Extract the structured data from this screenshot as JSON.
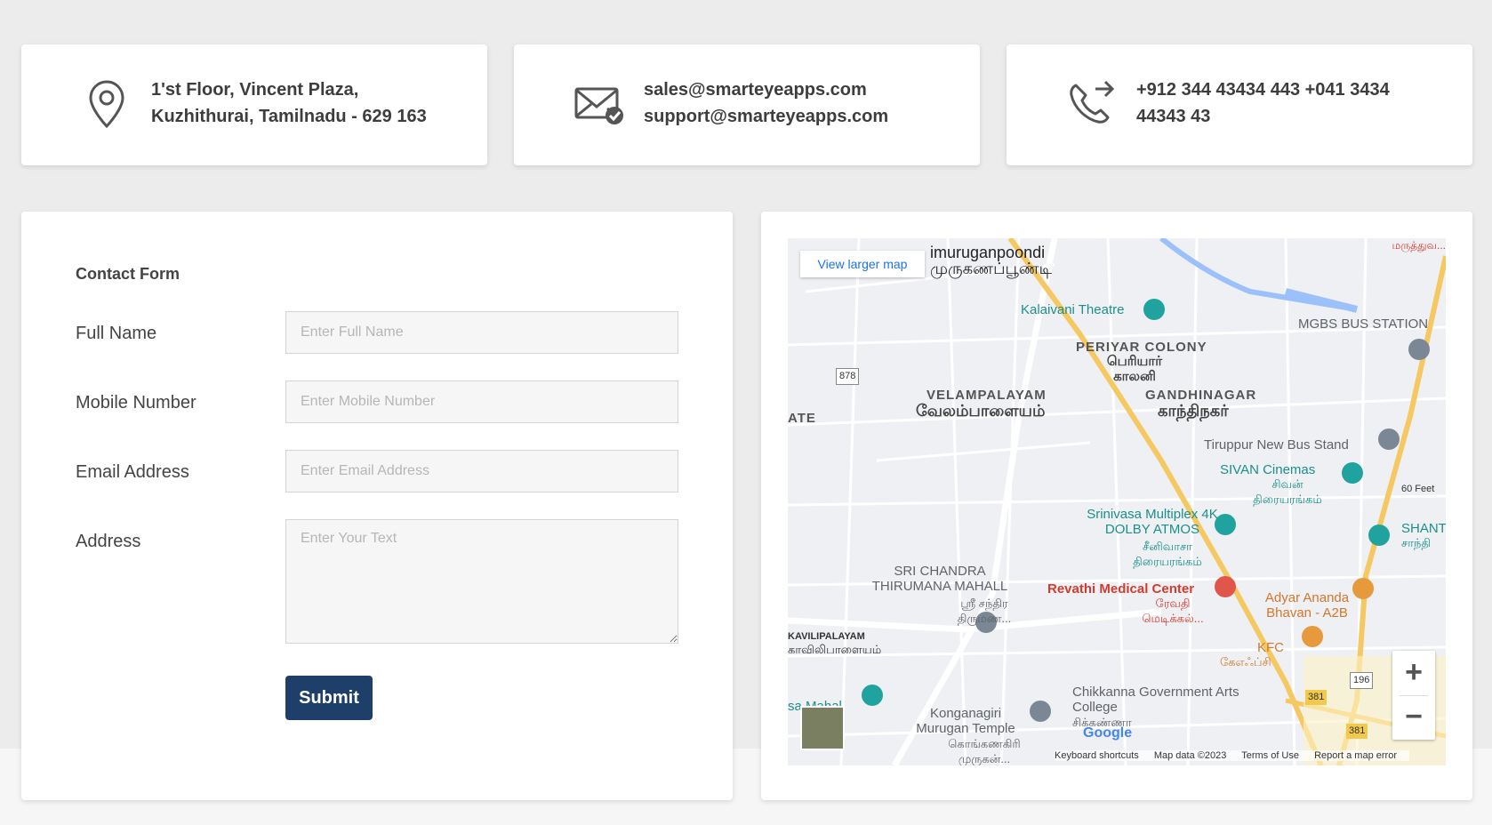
{
  "contact": {
    "address": {
      "line1": "1'st Floor, Vincent Plaza,",
      "line2": "Kuzhithurai, Tamilnadu - 629 163"
    },
    "email": {
      "line1": "sales@smarteyeapps.com",
      "line2": "support@smarteyeapps.com"
    },
    "phone": {
      "line1": "+912 344 43434 443 +041 3434",
      "line2": "44343 43"
    }
  },
  "form": {
    "title": "Contact Form",
    "colon": ":",
    "fields": [
      {
        "label": "Full Name",
        "placeholder": "Enter Full Name"
      },
      {
        "label": "Mobile Number",
        "placeholder": "Enter Mobile Number"
      },
      {
        "label": "Email Address",
        "placeholder": "Enter Email Address"
      },
      {
        "label": "Address",
        "placeholder": "Enter Your Text"
      }
    ],
    "submit_label": "Submit"
  },
  "map": {
    "view_larger": "View larger map",
    "zoom_in": "+",
    "zoom_out": "−",
    "attribution": {
      "shortcuts": "Keyboard shortcuts",
      "data": "Map data ©2023",
      "terms": "Terms of Use",
      "report": "Report a map error"
    },
    "google": "Google",
    "labels": {
      "top_area": "imuruganpoondi",
      "top_area_ta": "முருகணப்பூண்டி",
      "kalaivani": "Kalaivani Theatre",
      "periyar": "PERIYAR COLONY",
      "periyar_ta": "பெரியார் காலனி",
      "mgbs": "MGBS BUS STATION",
      "velampalayam": "VELAMPALAYAM",
      "velampalayam_ta": "வேலம்பாளையம்",
      "gandhinagar": "GANDHINAGAR",
      "gandhinagar_ta": "காந்திநகர்",
      "ate": "ATE",
      "tiruppur": "Tiruppur New Bus Stand",
      "sivan": "SIVAN Cinemas",
      "sivan_ta": "சிவன் திரையரங்கம்",
      "sixty_feet": "60 Feet",
      "srinivasa": "Srinivasa Multiplex 4K DOLBY ATMOS",
      "srinivasa_ta": "சீனிவாசா திரையரங்கம்",
      "shanthi": "SHANT",
      "shanthi_ta": "சாந்தி",
      "sri_chandra": "SRI CHANDRA THIRUMANA MAHALL",
      "sri_chandra_ta": "ஸ்ரீ சந்திர திருமண...",
      "revathi": "Revathi Medical Center",
      "revathi_ta": "ரேவதி மெடிக்கல்...",
      "adyar": "Adyar Ananda Bhavan - A2B",
      "kavilipalayam": "KAVILIPALAYAM",
      "kavilipalayam_ta": "காவிலிபாளையம்",
      "kfc": "KFC",
      "kfc_ta": "கேஎஃப்சி",
      "chikkanna": "Chikkanna Government Arts College",
      "chikkanna_ta": "சிக்கண்ணா",
      "konganagiri": "Konganagiri Murugan Temple",
      "konganagiri_ta": "கொங்கணகிரி முருகன்...",
      "mahal": "sa Mahal",
      "road_878": "878",
      "road_196": "196",
      "road_381a": "381",
      "road_381b": "381",
      "corner_ta": "மருத்துவ..."
    }
  }
}
